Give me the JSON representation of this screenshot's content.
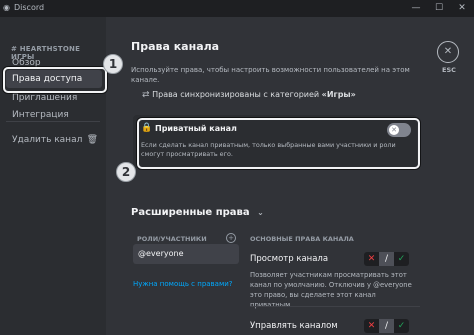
{
  "app": {
    "title": "Discord"
  },
  "sidebar": {
    "category": "HEARTHSTONE ИГРЫ",
    "items": [
      {
        "label": "Обзор"
      },
      {
        "label": "Права доступа",
        "active": true
      },
      {
        "label": "Приглашения"
      },
      {
        "label": "Интеграция"
      }
    ],
    "delete_label": "Удалить канал"
  },
  "header": {
    "esc_label": "ESC"
  },
  "main": {
    "title": "Права канала",
    "description": "Используйте права, чтобы настроить возможности пользователей на этом канале.",
    "sync_prefix": "Права синхронизированы с категорией ",
    "sync_category": "«Игры»",
    "private": {
      "label": "Приватный канал",
      "description": "Если сделать канал приватным, только выбранные вами участники и роли смогут просматривать его."
    },
    "advanced": {
      "title": "Расширенные права",
      "roles_header": "РОЛИ/УЧАСТНИКИ",
      "selected_role": "@everyone",
      "help_link": "Нужна помощь с правами?",
      "basic_header": "ОСНОВНЫЕ ПРАВА КАНАЛА",
      "permissions": [
        {
          "name": "Просмотр канала",
          "description": "Позволяет участникам просматривать этот канал по умолчанию. Отключив у @everyone это право, вы сделаете этот канал приватным."
        },
        {
          "name": "Управлять каналом"
        }
      ]
    }
  },
  "annotations": {
    "badge1": "1",
    "badge2": "2"
  },
  "colors": {
    "bg": "#313338",
    "sidebar": "#2b2d31",
    "link": "#00a8fc",
    "deny": "#f23f43",
    "allow": "#23a55a"
  }
}
